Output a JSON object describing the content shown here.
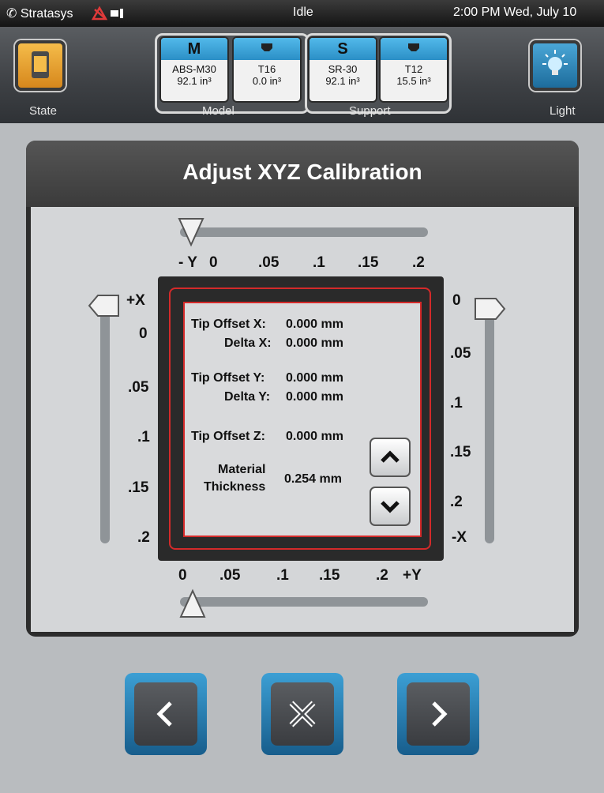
{
  "status": {
    "brand": "Stratasys",
    "state": "Idle",
    "clock": "2:00 PM Wed, July 10"
  },
  "header": {
    "state_label": "State",
    "light_label": "Light",
    "model_label": "Model",
    "support_label": "Support",
    "bays": [
      {
        "cap": "M",
        "line1": "ABS-M30",
        "line2": "92.1 in³"
      },
      {
        "cap": "",
        "line1": "T16",
        "line2": "0.0 in³"
      },
      {
        "cap": "S",
        "line1": "SR-30",
        "line2": "92.1 in³"
      },
      {
        "cap": "",
        "line1": "T12",
        "line2": "15.5 in³"
      }
    ]
  },
  "panel": {
    "title": "Adjust XYZ Calibration",
    "top_axis": {
      "neg_label": "- Y",
      "ticks": [
        "0",
        ".05",
        ".1",
        ".15",
        ".2"
      ]
    },
    "bottom_axis": {
      "ticks": [
        "0",
        ".05",
        ".1",
        ".15",
        ".2"
      ],
      "pos_label": "+Y"
    },
    "left_axis": {
      "pos_label": "+X",
      "ticks": [
        "0",
        ".05",
        ".1",
        ".15",
        ".2"
      ]
    },
    "right_axis": {
      "ticks": [
        "0",
        ".05",
        ".1",
        ".15",
        ".2"
      ],
      "neg_label": "-X"
    },
    "info": {
      "tip_offset_x_label": "Tip Offset X:",
      "tip_offset_x": "0.000 mm",
      "delta_x_label": "Delta X:",
      "delta_x": "0.000 mm",
      "tip_offset_y_label": "Tip Offset Y:",
      "tip_offset_y": "0.000 mm",
      "delta_y_label": "Delta Y:",
      "delta_y": "0.000 mm",
      "tip_offset_z_label": "Tip Offset Z:",
      "tip_offset_z": "0.000 mm",
      "material_label_1": "Material",
      "material_label_2": "Thickness",
      "material_thickness": "0.254 mm"
    }
  },
  "colors": {
    "accent_blue": "#2b8fc6",
    "state_orange": "#e8a233",
    "outline_red": "#d42a2a"
  }
}
